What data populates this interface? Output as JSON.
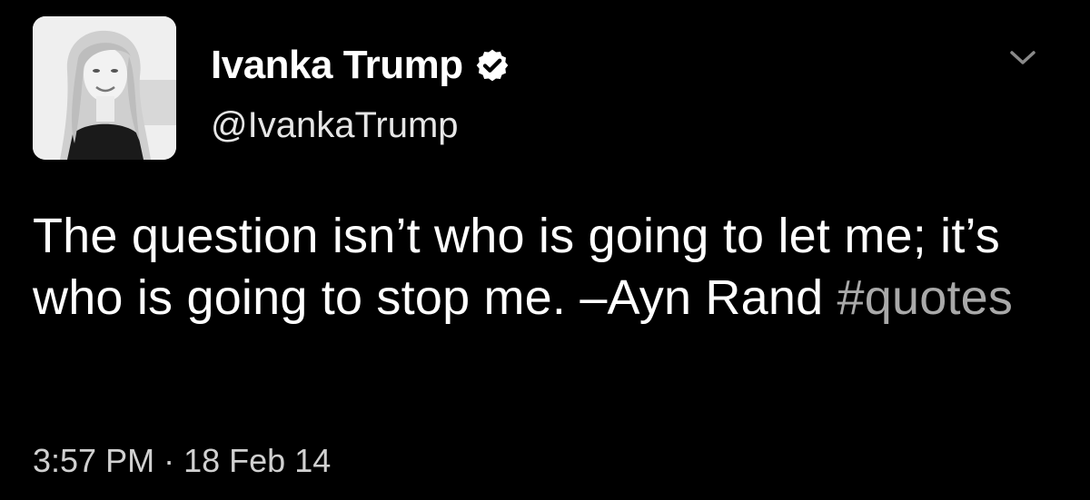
{
  "tweet": {
    "author": {
      "display_name": "Ivanka Trump",
      "handle": "@IvankaTrump",
      "verified": true
    },
    "text_main": "The question isn’t who is going to let me; it’s who is going to stop me. –Ayn Rand ",
    "hashtag": "#quotes",
    "time": "3:57 PM",
    "separator": "·",
    "date": "18 Feb 14"
  },
  "icons": {
    "verified": "verified-badge-icon",
    "menu": "chevron-down-icon"
  },
  "colors": {
    "background": "#000000",
    "text": "#ffffff",
    "hashtag": "#a9a9a9",
    "meta": "#d0d0d0"
  }
}
